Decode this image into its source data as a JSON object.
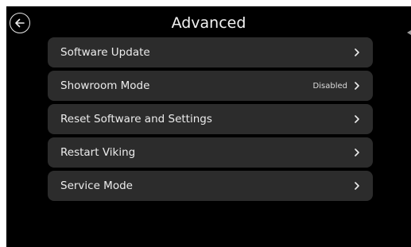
{
  "header": {
    "title": "Advanced",
    "back_icon": "arrow-left-icon"
  },
  "menu": {
    "items": [
      {
        "label": "Software Update",
        "value": "",
        "icon": "chevron-right-icon"
      },
      {
        "label": "Showroom Mode",
        "value": "Disabled",
        "icon": "chevron-right-icon"
      },
      {
        "label": "Reset Software and Settings",
        "value": "",
        "icon": "chevron-right-icon"
      },
      {
        "label": "Restart Viking",
        "value": "",
        "icon": "chevron-right-icon"
      },
      {
        "label": "Service Mode",
        "value": "",
        "icon": "chevron-right-icon"
      }
    ]
  },
  "colors": {
    "background": "#000000",
    "row_background": "#2c2c2c",
    "text": "#ececec"
  }
}
